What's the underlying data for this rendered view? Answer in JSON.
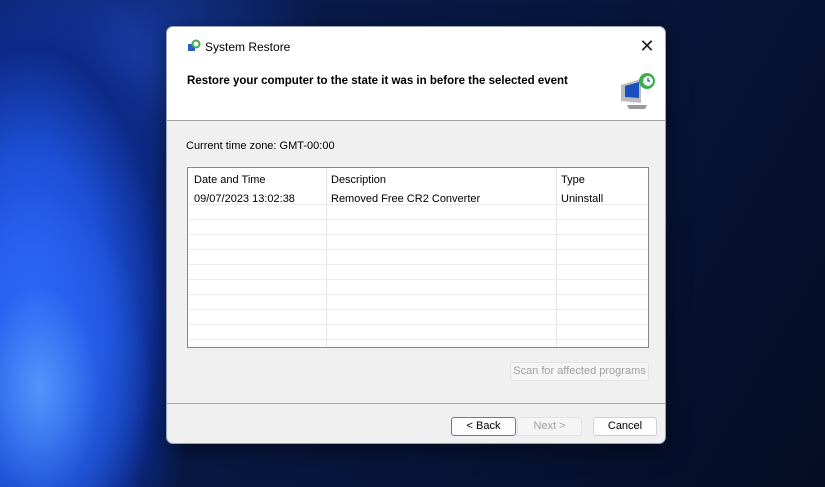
{
  "window": {
    "title": "System Restore",
    "close_icon": "close-icon"
  },
  "heading": "Restore your computer to the state it was in before the selected event",
  "timezone": "Current time zone: GMT-00:00",
  "table": {
    "columns": [
      "Date and Time",
      "Description",
      "Type"
    ],
    "rows": [
      {
        "date": "09/07/2023 13:02:38",
        "description": "Removed Free CR2 Converter",
        "type": "Uninstall"
      }
    ]
  },
  "buttons": {
    "scan": "Scan for affected programs",
    "back": "< Back",
    "next": "Next >",
    "cancel": "Cancel"
  }
}
